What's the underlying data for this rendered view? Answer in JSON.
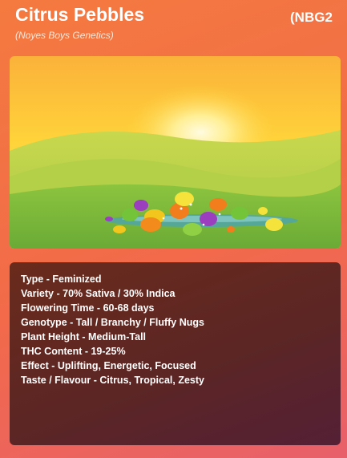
{
  "header": {
    "title": "Citrus Pebbles",
    "code": "(NBG2",
    "breeder": "(Noyes Boys Genetics)"
  },
  "artwork": {
    "icon": "sunrise-landscape-with-candy-pebbles-icon",
    "colors": {
      "sky_top": "#f9a22a",
      "sun": "#fff6a8",
      "hill_far": "#b9cf45",
      "hill_near": "#7ab63a",
      "pond": "#4fa6a8"
    }
  },
  "traits": [
    {
      "label": "Type",
      "value": "Feminized"
    },
    {
      "label": "Variety",
      "value": "70% Sativa / 30% Indica"
    },
    {
      "label": "Flowering Time",
      "value": "60-68 days"
    },
    {
      "label": "Genotype",
      "value": "Tall / Branchy / Fluffy Nugs"
    },
    {
      "label": "Plant Height",
      "value": "Medium-Tall"
    },
    {
      "label": "THC Content",
      "value": "19-25%"
    },
    {
      "label": "Effect",
      "value": "Uplifting, Energetic, Focused"
    },
    {
      "label": "Taste / Flavour",
      "value": "Citrus, Tropical, Zesty"
    }
  ]
}
